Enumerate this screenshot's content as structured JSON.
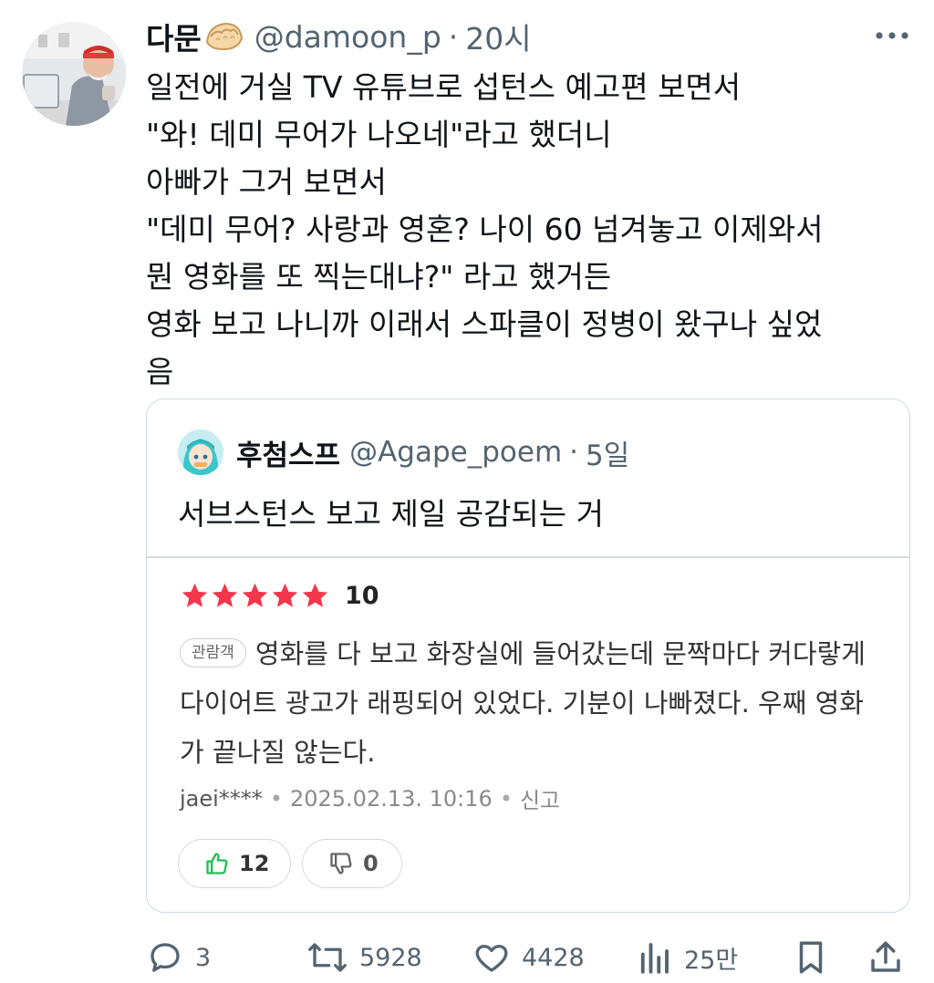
{
  "tweet": {
    "display_name": "다문",
    "emoji_icon": "dumpling-emoji",
    "handle": "@damoon_p",
    "separator": "·",
    "time": "20시",
    "text": "일전에 거실 TV 유튜브로 섭턴스 예고편 보면서\n\"와! 데미 무어가 나오네\"라고 했더니\n아빠가 그거 보면서\n\"데미 무어? 사랑과 영혼? 나이 60 넘겨놓고 이제와서\n뭔 영화를 또 찍는대냐?\" 라고 했거든\n영화 보고 나니까 이래서 스파클이 정병이 왔구나 싶었\n음"
  },
  "quote": {
    "display_name": "후첨스프",
    "handle": "@Agape_poem",
    "separator": "·",
    "time": "5일",
    "text": "서브스턴스 보고 제일 공감되는 거",
    "review": {
      "stars": 5,
      "rating": "10",
      "badge": "관람객",
      "body": "영화를 다 보고 화장실에 들어갔는데 문짝마다 커다랗게 다이어트 광고가 래핑되어 있었다. 기분이 나빠졌다. 우째 영화가 끝나질 않는다.",
      "user": "jaei****",
      "sep1": "•",
      "datetime": "2025.02.13. 10:16",
      "sep2": "•",
      "report": "신고",
      "likes": "12",
      "dislikes": "0"
    }
  },
  "actions": {
    "reply_count": "3",
    "retweet_count": "5928",
    "like_count": "4428",
    "view_count": "25만"
  },
  "colors": {
    "text": "#0f1419",
    "secondary": "#536471",
    "star": "#f2364b",
    "thumb_up": "#1fbf52",
    "border": "#cfd9de"
  }
}
